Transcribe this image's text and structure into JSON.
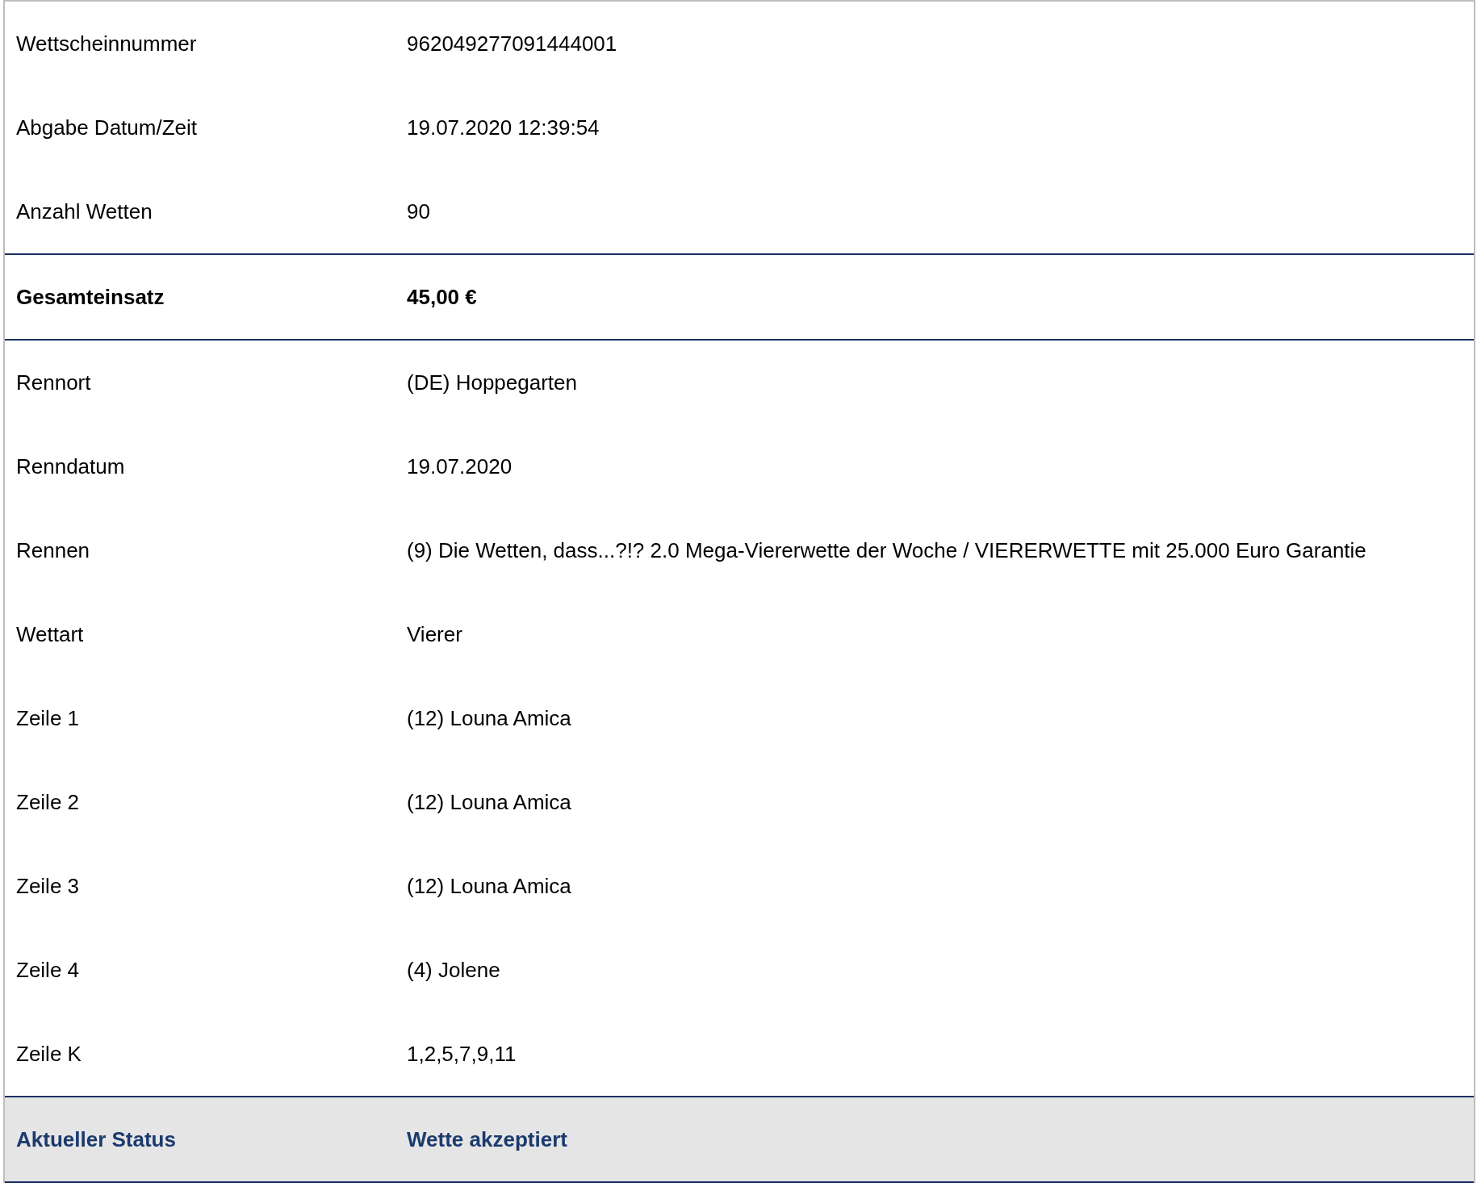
{
  "sections": [
    {
      "kind": "plain",
      "rows": [
        {
          "label": "Wettscheinnummer",
          "value": "962049277091444001"
        },
        {
          "label": "Abgabe Datum/Zeit",
          "value": "19.07.2020 12:39:54"
        },
        {
          "label": "Anzahl Wetten",
          "value": "90"
        }
      ]
    },
    {
      "kind": "total",
      "rows": [
        {
          "label": "Gesamteinsatz",
          "value": "45,00 €"
        }
      ]
    },
    {
      "kind": "plain",
      "rows": [
        {
          "label": "Rennort",
          "value": "(DE) Hoppegarten"
        },
        {
          "label": "Renndatum",
          "value": "19.07.2020"
        },
        {
          "label": "Rennen",
          "value": "(9) Die Wetten, dass...?!? 2.0 Mega-Viererwette der Woche / VIERERWETTE mit 25.000 Euro Garantie"
        },
        {
          "label": "Wettart",
          "value": "Vierer"
        },
        {
          "label": "Zeile 1",
          "value": "(12) Louna Amica"
        },
        {
          "label": "Zeile 2",
          "value": "(12) Louna Amica"
        },
        {
          "label": "Zeile 3",
          "value": "(12) Louna Amica"
        },
        {
          "label": "Zeile 4",
          "value": "(4) Jolene"
        },
        {
          "label": "Zeile K",
          "value": "1,2,5,7,9,11"
        }
      ]
    },
    {
      "kind": "status",
      "rows": [
        {
          "label": "Aktueller Status",
          "value": "Wette akzeptiert"
        }
      ]
    }
  ]
}
